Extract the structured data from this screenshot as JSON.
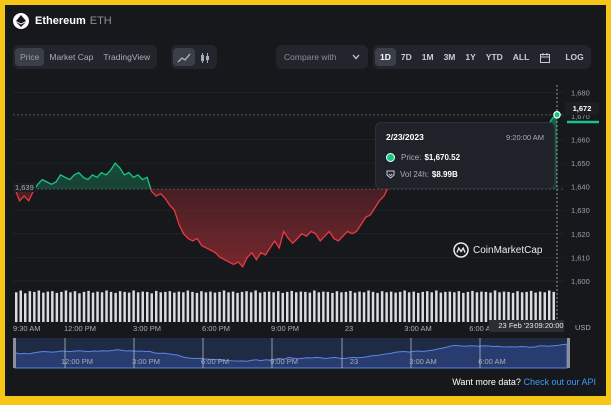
{
  "coin": {
    "name": "Ethereum",
    "symbol": "ETH"
  },
  "view_tabs": [
    {
      "label": "Price",
      "active": true
    },
    {
      "label": "Market Cap",
      "active": false
    },
    {
      "label": "TradingView",
      "active": false
    }
  ],
  "chart_type_icons": [
    "line-chart-icon",
    "candlestick-icon"
  ],
  "compare": {
    "label": "Compare with"
  },
  "ranges": [
    {
      "label": "1D",
      "active": true
    },
    {
      "label": "7D",
      "active": false
    },
    {
      "label": "1M",
      "active": false
    },
    {
      "label": "3M",
      "active": false
    },
    {
      "label": "1Y",
      "active": false
    },
    {
      "label": "YTD",
      "active": false
    },
    {
      "label": "ALL",
      "active": false
    }
  ],
  "log_label": "LOG",
  "tooltip": {
    "date": "2/23/2023",
    "time": "9:20:00 AM",
    "price_label": "Price:",
    "price_value": "$1,670.52",
    "vol_label": "Vol 24h:",
    "vol_value": "$8.99B"
  },
  "watermark": "CoinMarketCap",
  "current_price_label": "1,672",
  "start_price_label": "1,639",
  "crosshair_date": "23 Feb '23",
  "crosshair_time": "09:20:00",
  "currency_label": "USD",
  "footer": {
    "text": "Want more data?",
    "link": "Check out our API"
  },
  "colors": {
    "up": "#16c784",
    "down": "#ea3943",
    "background": "#17181b",
    "frame": "#f5c518",
    "link": "#3a9bff"
  },
  "chart_data": {
    "type": "area",
    "ylim": [
      1597,
      1684
    ],
    "yticks": [
      1600,
      1610,
      1620,
      1630,
      1640,
      1650,
      1660,
      1670,
      1680
    ],
    "ytick_labels": [
      "1,600",
      "1,610",
      "1,620",
      "1,630",
      "1,640",
      "1,650",
      "1,660",
      "1,670",
      "1,680"
    ],
    "baseline": 1639,
    "xtick_labels": [
      "9:30 AM",
      "12:00 PM",
      "3:00 PM",
      "6:00 PM",
      "9:00 PM",
      "23",
      "3:00 AM",
      "6:00 AM"
    ],
    "navigator_labels": [
      "12:00 PM",
      "3:00 PM",
      "6:00 PM",
      "9:00 PM",
      "23",
      "3:00 AM",
      "6:00 AM"
    ],
    "series": [
      {
        "values": [
          1639,
          1634,
          1636,
          1634,
          1638,
          1641,
          1643,
          1642,
          1641,
          1642,
          1645,
          1644,
          1643,
          1645,
          1646,
          1644,
          1643,
          1645,
          1644,
          1646,
          1645,
          1647,
          1650,
          1648,
          1645,
          1646,
          1644,
          1645,
          1643,
          1644,
          1638,
          1636,
          1637,
          1635,
          1632,
          1630,
          1624,
          1620,
          1618,
          1617,
          1618,
          1615,
          1614,
          1613,
          1612,
          1610,
          1609,
          1608,
          1607,
          1608,
          1606,
          1610,
          1612,
          1609,
          1612,
          1611,
          1614,
          1617,
          1614,
          1621,
          1618,
          1616,
          1618,
          1620,
          1619,
          1621,
          1620,
          1617,
          1619,
          1621,
          1618,
          1617,
          1619,
          1621,
          1620,
          1621,
          1624,
          1627,
          1628,
          1631,
          1634,
          1636,
          1640,
          1642,
          1643,
          1641,
          1644,
          1645,
          1643,
          1646,
          1648,
          1652,
          1655,
          1659,
          1664,
          1666,
          1664,
          1663,
          1665,
          1664,
          1663,
          1665,
          1664,
          1662,
          1663,
          1661,
          1660,
          1661,
          1660,
          1662,
          1661,
          1659,
          1660,
          1664,
          1664,
          1663,
          1665,
          1666,
          1669,
          1670.52
        ]
      }
    ],
    "volume": [
      0.85,
      0.9,
      0.82,
      0.88,
      0.86,
      0.9,
      0.84,
      0.87,
      0.88,
      0.83,
      0.86,
      0.9,
      0.85,
      0.88,
      0.82,
      0.86,
      0.89,
      0.84,
      0.87,
      0.85,
      0.9,
      0.86,
      0.83,
      0.88,
      0.86,
      0.84,
      0.9,
      0.85,
      0.87,
      0.86,
      0.82,
      0.89,
      0.85,
      0.86,
      0.88,
      0.84,
      0.87,
      0.85,
      0.9,
      0.86,
      0.83,
      0.88,
      0.85,
      0.87,
      0.84,
      0.86,
      0.9,
      0.85,
      0.87,
      0.83,
      0.86,
      0.88,
      0.85,
      0.9,
      0.84,
      0.86,
      0.87,
      0.85,
      0.88,
      0.83,
      0.86,
      0.89,
      0.85,
      0.87,
      0.86,
      0.84,
      0.9,
      0.85,
      0.87,
      0.86,
      0.83,
      0.88,
      0.85,
      0.86,
      0.89,
      0.84,
      0.87,
      0.85,
      0.9,
      0.86,
      0.83,
      0.88,
      0.85,
      0.87,
      0.84,
      0.86,
      0.9,
      0.85,
      0.87,
      0.83,
      0.86,
      0.88,
      0.85,
      0.9,
      0.84,
      0.86,
      0.87,
      0.85,
      0.88,
      0.83,
      0.86,
      0.89,
      0.85,
      0.87,
      0.86,
      0.84,
      0.9,
      0.85,
      0.87,
      0.86,
      0.83,
      0.88,
      0.85,
      0.86,
      0.89,
      0.84,
      0.87,
      0.85,
      0.9,
      0.86
    ]
  }
}
